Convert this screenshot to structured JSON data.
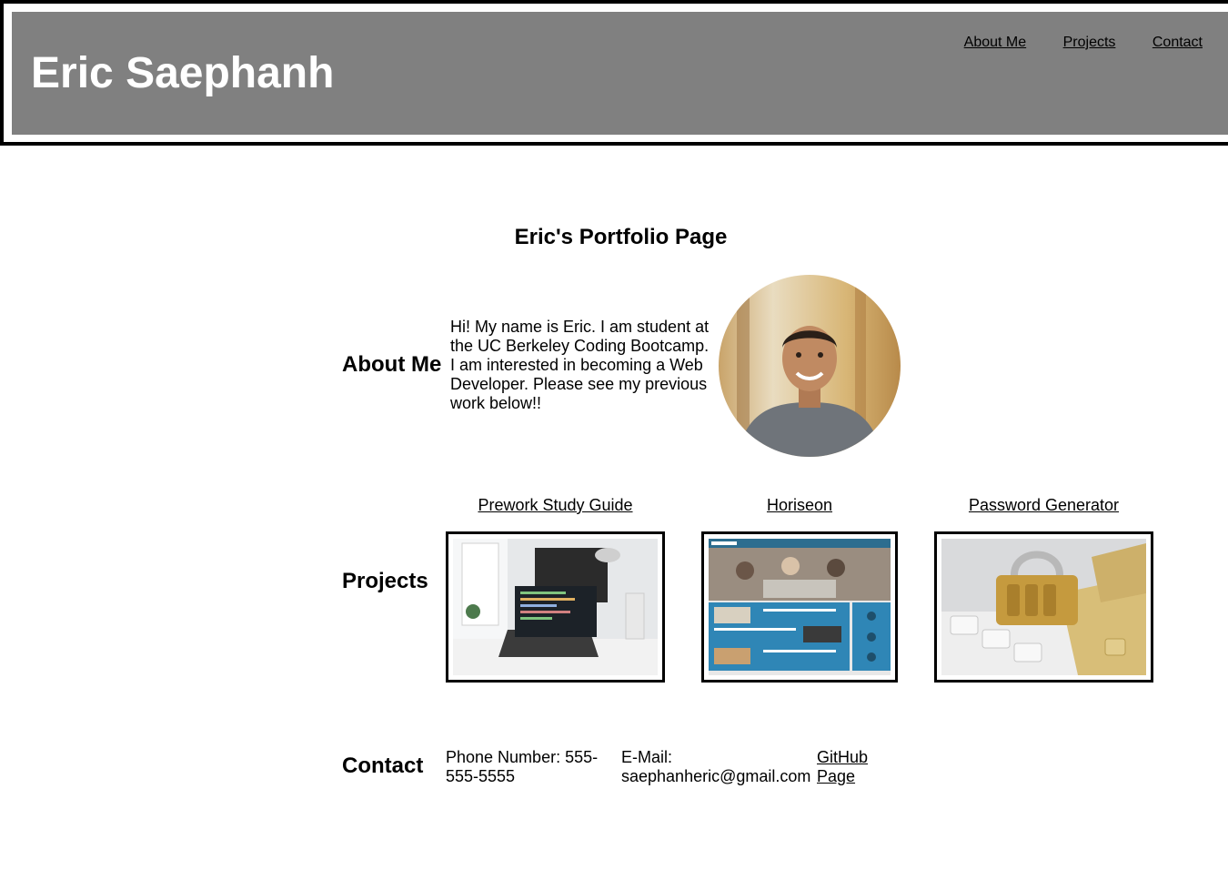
{
  "header": {
    "site_title": "Eric Saephanh",
    "nav": [
      "About Me",
      "Projects",
      "Contact"
    ]
  },
  "page_title": "Eric's Portfolio Page",
  "about": {
    "heading": "About Me",
    "text": "Hi! My name is Eric. I am student at the UC Berkeley Coding Bootcamp. I am interested in becoming a Web Developer. Please see my previous work below!!"
  },
  "projects": {
    "heading": "Projects",
    "items": [
      {
        "title": "Prework Study Guide",
        "image": "laptop-desk-photo"
      },
      {
        "title": "Horiseon",
        "image": "horiseon-website-screenshot"
      },
      {
        "title": "Password Generator",
        "image": "padlock-on-keyboard-photo"
      }
    ]
  },
  "contact": {
    "heading": "Contact",
    "phone": "Phone Number: 555-555-5555",
    "email_label": "E-Mail:",
    "email": "saephanheric@gmail.com",
    "github": "GitHub Page"
  },
  "colors": {
    "header_bg": "#808080",
    "title_text": "#ffffff",
    "border": "#000000"
  }
}
